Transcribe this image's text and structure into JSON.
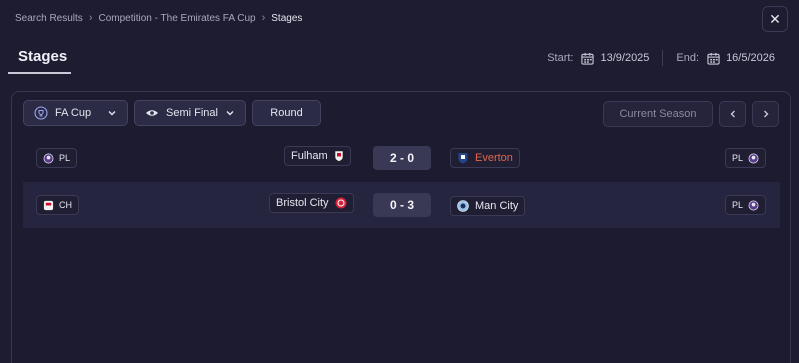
{
  "breadcrumb": {
    "items": [
      "Search Results",
      "Competition - The Emirates FA Cup",
      "Stages"
    ]
  },
  "header": {
    "title": "Stages",
    "start_label": "Start:",
    "start_value": "13/9/2025",
    "end_label": "End:",
    "end_value": "16/5/2026"
  },
  "filters": {
    "competition": "FA Cup",
    "stage": "Semi Final",
    "round_label": "Round",
    "season_label": "Current Season"
  },
  "matches": [
    {
      "home_league": "PL",
      "home_team": "Fulham",
      "score": "2 - 0",
      "away_team": "Everton",
      "away_team_color": "#e0674c",
      "away_league": "PL"
    },
    {
      "home_league": "CH",
      "home_team": "Bristol City",
      "score": "0 - 3",
      "away_team": "Man City",
      "away_team_color": "#e6e6f0",
      "away_league": "PL"
    }
  ],
  "icons": {
    "close": "close-icon",
    "calendar": "calendar-icon",
    "competition": "trophy-icon",
    "stage": "eye-icon",
    "prev": "chevron-left-icon",
    "next": "chevron-right-icon"
  }
}
